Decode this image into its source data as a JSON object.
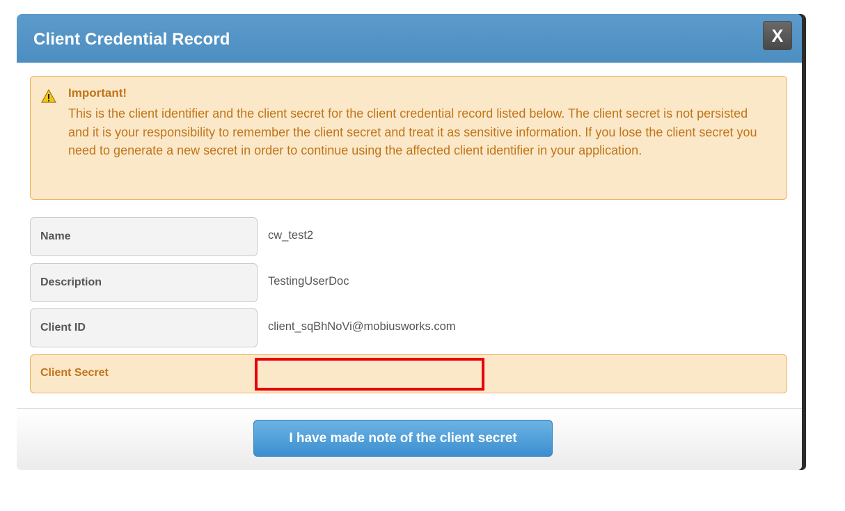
{
  "dialog": {
    "title": "Client Credential Record",
    "close_label": "X"
  },
  "alert": {
    "icon": "warning-icon",
    "heading": "Important!",
    "message": "This is the client identifier and the client secret for the client credential record listed below. The client secret is not persisted and it is your responsibility to remember the client secret and treat it as sensitive information. If you lose the client secret you need to generate a new secret in order to continue using the affected client identifier in your application."
  },
  "fields": [
    {
      "label": "Name",
      "value": "cw_test2"
    },
    {
      "label": "Description",
      "value": "TestingUserDoc"
    },
    {
      "label": "Client ID",
      "value": "client_sqBhNoVi@mobiusworks.com"
    }
  ],
  "secret": {
    "label": "Client Secret",
    "value": ""
  },
  "footer": {
    "confirm_label": "I have made note of the client secret"
  },
  "colors": {
    "header": "#5296c8",
    "alert_bg": "#fbe8c8",
    "alert_text": "#c0741a",
    "highlight": "#e8000b",
    "button": "#4a9ad6"
  }
}
